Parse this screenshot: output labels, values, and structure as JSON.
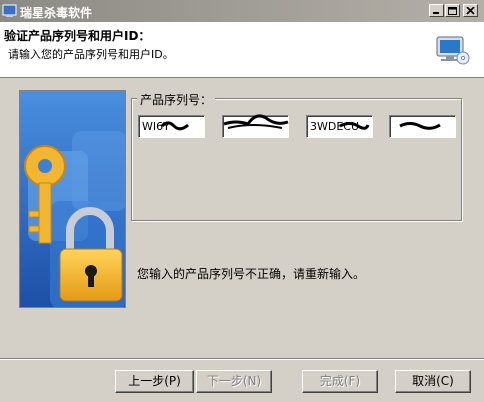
{
  "window": {
    "title": "瑞星杀毒软件",
    "minimize_icon": "minimize-icon",
    "maximize_icon": "maximize-icon",
    "close_icon": "close-icon"
  },
  "header": {
    "title": "验证产品序列号和用户ID：",
    "subtitle": "请输入您的产品序列号和用户ID。",
    "icon": "monitor-cd-icon"
  },
  "serial_group": {
    "label": "产品序列号：",
    "fields": [
      "WI6Y",
      "",
      "3WDECU",
      ""
    ]
  },
  "message": "您输入的产品序列号不正确，请重新输入。",
  "buttons": {
    "back": "上一步(P)",
    "next": "下一步(N)",
    "finish": "完成(F)",
    "cancel": "取消(C)"
  },
  "colors": {
    "face": "#d4d0c8",
    "key_gold": "#f2b632",
    "art_blue": "#2f6fc4"
  }
}
